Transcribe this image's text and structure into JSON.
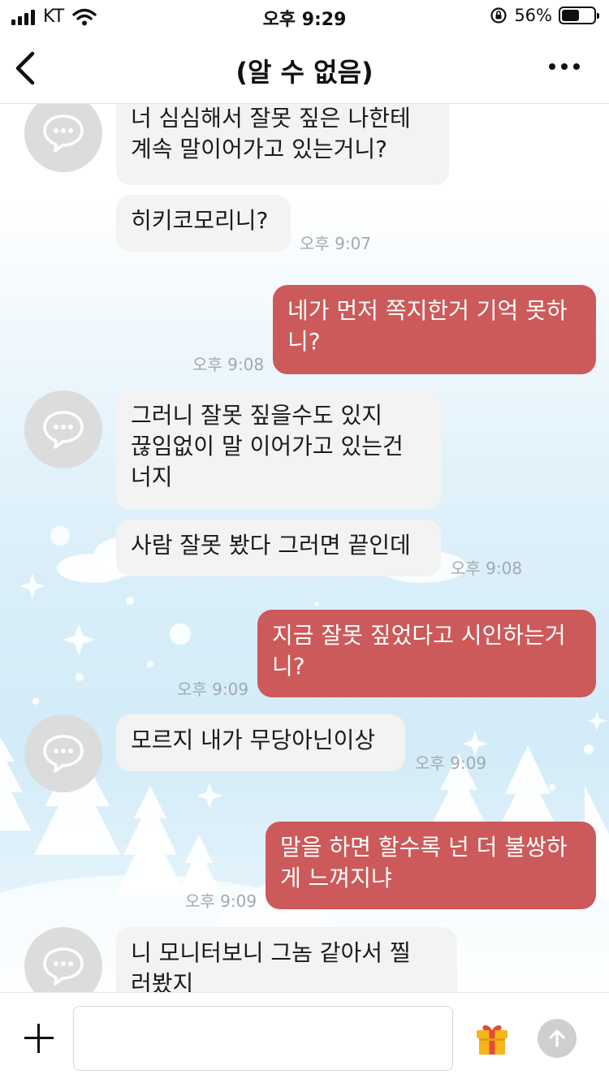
{
  "status_bar": {
    "carrier": "KT",
    "time": "오후 9:29",
    "battery_percent": "56%",
    "battery_level": 0.56
  },
  "header": {
    "title": "(알 수 없음)",
    "back_icon": "chevron-left-icon",
    "more_icon": "more-dots-icon"
  },
  "messages": [
    {
      "from": "other",
      "text": "너 심심해서 잘못 짚은 나한테\n계속 말이어가고 있는거니?",
      "time": ""
    },
    {
      "from": "other",
      "text": "히키코모리니?",
      "time": "오후 9:07"
    },
    {
      "from": "me",
      "text": "네가 먼저 쪽지한거 기억 못하\n니?",
      "time": "오후 9:08"
    },
    {
      "from": "other",
      "text": "그러니 잘못 짚을수도 있지\n끊임없이 말 이어가고 있는건\n너지",
      "time": ""
    },
    {
      "from": "other",
      "text": "사람 잘못 봤다 그러면 끝인데",
      "time": "오후 9:08"
    },
    {
      "from": "me",
      "text": "지금 잘못 짚었다고 시인하는거\n니?",
      "time": "오후 9:09"
    },
    {
      "from": "other",
      "text": "모르지 내가 무당아닌이상",
      "time": "오후 9:09"
    },
    {
      "from": "me",
      "text": "말을 하면 할수록 넌 더 불쌍하\n게 느껴지냐",
      "time": "오후 9:09"
    },
    {
      "from": "other",
      "text": "니 모니터보니 그놈 같아서 찔\n러봤지",
      "time": ""
    }
  ],
  "composer": {
    "input_value": "",
    "plus_icon": "plus-icon",
    "gift_icon": "gift-icon",
    "send_icon": "send-arrow-icon"
  },
  "colors": {
    "outgoing_bubble": "#cc5a5a",
    "incoming_bubble": "#f3f3f3",
    "timestamp": "#a4a9ae"
  }
}
